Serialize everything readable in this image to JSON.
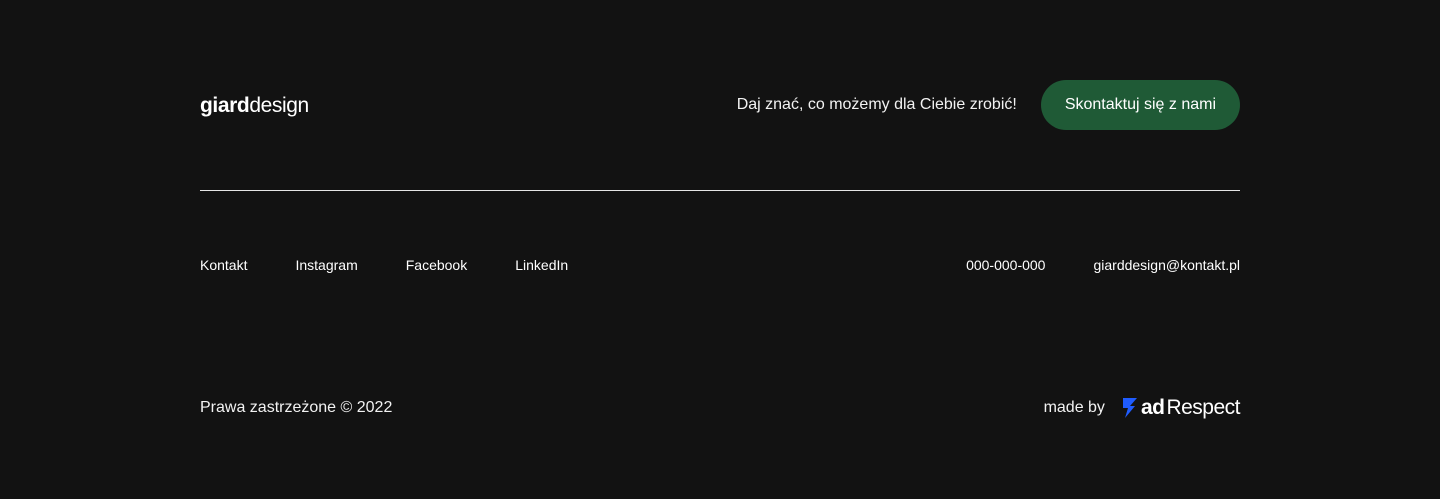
{
  "brand": {
    "logo_bold": "giard",
    "logo_light": "design"
  },
  "cta": {
    "text": "Daj znać, co możemy dla Ciebie zrobić!",
    "button_label": "Skontaktuj się z nami",
    "button_color": "#1f5a36"
  },
  "nav": {
    "items": [
      {
        "label": "Kontakt"
      },
      {
        "label": "Instagram"
      },
      {
        "label": "Facebook"
      },
      {
        "label": "LinkedIn"
      }
    ]
  },
  "contact": {
    "phone": "000-000-000",
    "email": "giarddesign@kontakt.pl"
  },
  "footer": {
    "copyright": "Prawa zastrzeżone © 2022",
    "made_by_label": "made by",
    "agency_bold": "ad",
    "agency_light": "Respect",
    "agency_icon": "adrespect-mark-icon",
    "agency_icon_color": "#1f5cff"
  },
  "colors": {
    "background": "#121212",
    "text": "#ffffff",
    "divider": "#e6e6e6"
  }
}
